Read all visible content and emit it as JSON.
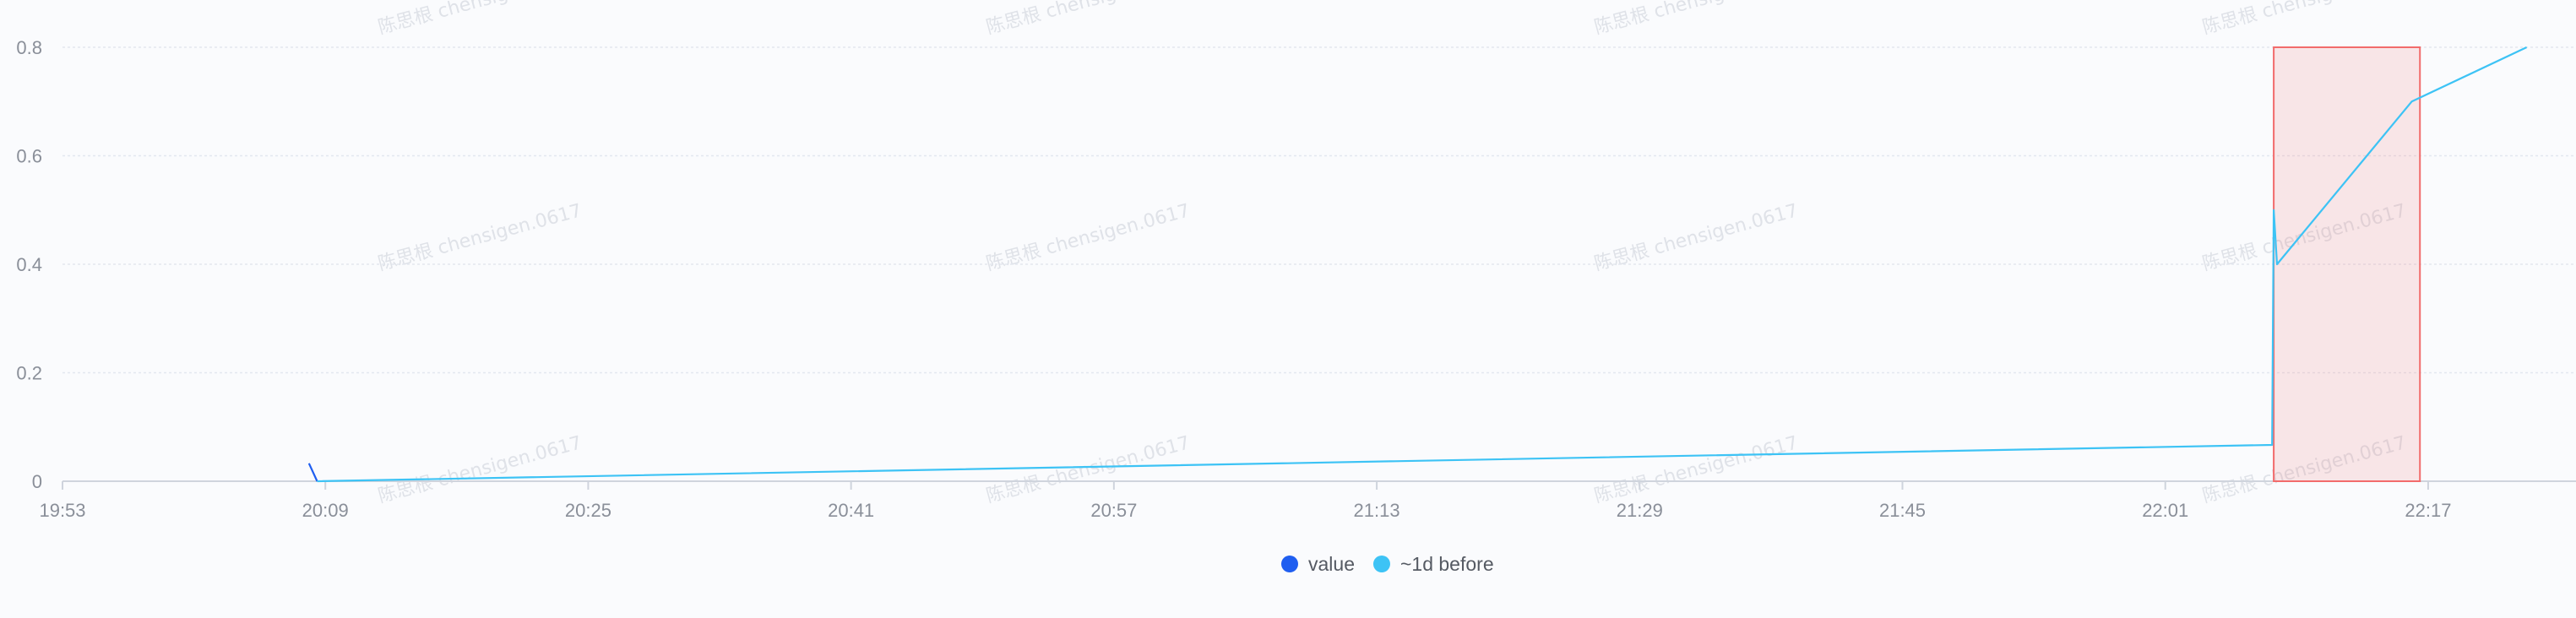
{
  "chart_data": {
    "type": "line",
    "x_ticks": [
      "19:53",
      "20:09",
      "20:25",
      "20:41",
      "20:57",
      "21:13",
      "21:29",
      "21:45",
      "22:01",
      "22:17"
    ],
    "xlim": [
      "19:53",
      "22:26"
    ],
    "ylim": [
      0,
      0.8
    ],
    "y_ticks": [
      "0",
      "0.2",
      "0.4",
      "0.6",
      "0.8"
    ],
    "grid": true,
    "legend_position": "bottom-center",
    "watermark_text": "陈思根 chensigen.0617",
    "series": [
      {
        "name": "value",
        "color": "#1f5ef0",
        "points": [
          [
            "20:08",
            0.033
          ],
          [
            "20:08:30",
            0.0
          ]
        ]
      },
      {
        "name": "~1d before",
        "color": "#3dc3f5",
        "points": [
          [
            "20:08:30",
            0.0
          ],
          [
            "22:07:30",
            0.067
          ],
          [
            "22:07:36",
            0.5
          ],
          [
            "22:07:48",
            0.4
          ],
          [
            "22:16",
            0.7
          ],
          [
            "22:23",
            0.8
          ]
        ]
      }
    ],
    "highlight_region": {
      "x_range": [
        "22:07:36",
        "22:16:30"
      ],
      "y_range": [
        0,
        0.8
      ],
      "color": "#f26b6b"
    }
  }
}
